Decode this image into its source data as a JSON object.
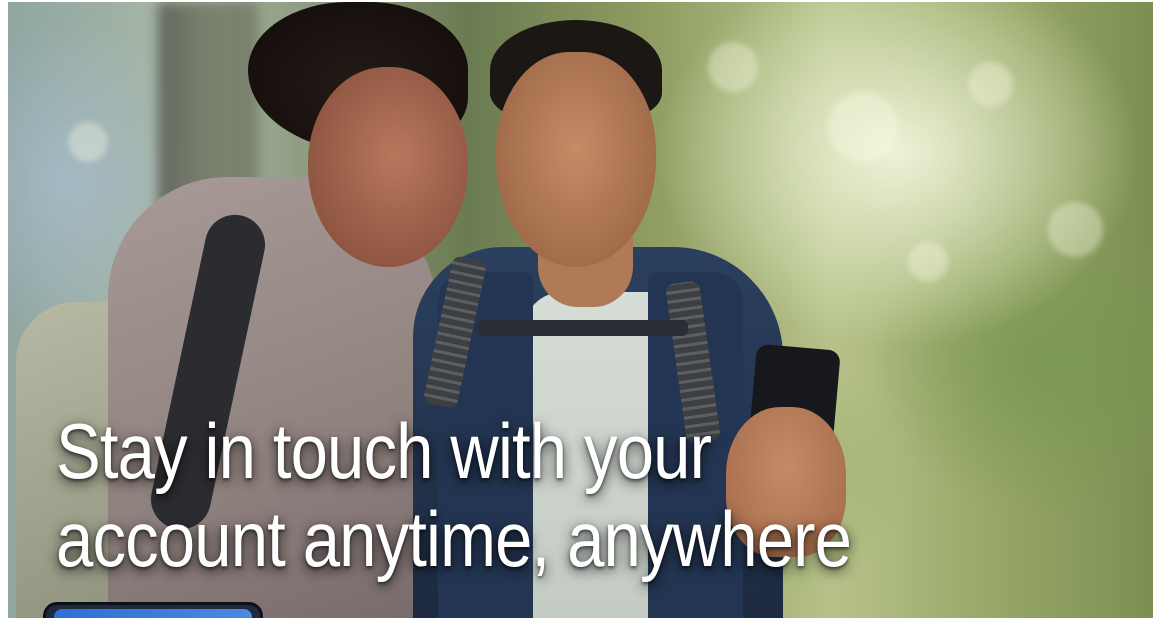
{
  "hero": {
    "headline_line1": "Stay in touch with your",
    "headline_line2": "account anytime, anywhere",
    "image_alt": "couple-looking-at-phone-outdoors"
  },
  "colors": {
    "headline_text": "#ffffff",
    "background": "#ffffff"
  }
}
